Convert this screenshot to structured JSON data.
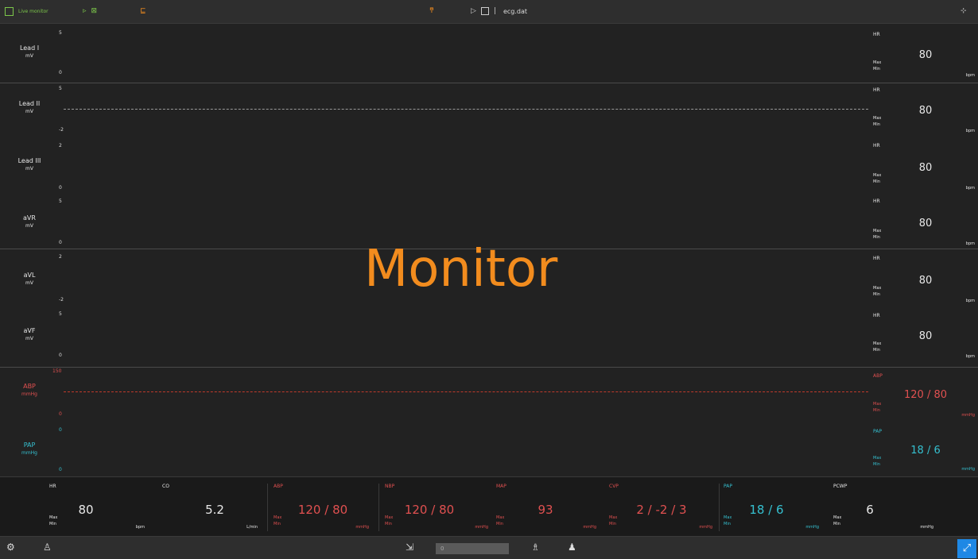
{
  "colors": {
    "green": "#7cc74a",
    "orange": "#f28c1e",
    "red": "#e05050",
    "cyan": "#35c0d0",
    "white": "#e8e8e8"
  },
  "topbar": {
    "logo_text": "Live monitor",
    "play_icon": "play-icon",
    "step_icon": "step-icon",
    "record_icon": "record-icon",
    "alarm_icon": "alarm-icon",
    "pause_icon": "pause-icon",
    "forward_icon": "forward-icon",
    "stop_icon": "stop-icon",
    "file_name": "ecg.dat",
    "settings_icon": "settings-icon"
  },
  "channels": [
    {
      "label": "Lead I",
      "unit": "mV",
      "top": "5",
      "bottom": "0"
    },
    {
      "label": "Lead II",
      "unit": "mV",
      "top": "5",
      "bottom": "-2"
    },
    {
      "label": "Lead III",
      "unit": "mV",
      "top": "2",
      "bottom": "0"
    },
    {
      "label": "aVR",
      "unit": "mV",
      "top": "5",
      "bottom": "0"
    },
    {
      "label": "aVL",
      "unit": "mV",
      "top": "2",
      "bottom": "-2"
    },
    {
      "label": "aVF",
      "unit": "mV",
      "top": "5",
      "bottom": "0"
    },
    {
      "label": "ABP",
      "unit": "mmHg",
      "top": "150",
      "bottom": "0"
    },
    {
      "label": "PAP",
      "unit": "mmHg",
      "top": "0",
      "bottom": "0"
    }
  ],
  "right_params": [
    {
      "label": "HR",
      "value": "80",
      "sub1": "Max",
      "sub2": "Min",
      "unit": "bpm"
    },
    {
      "label": "HR",
      "value": "80",
      "sub1": "Max",
      "sub2": "Min",
      "unit": "bpm"
    },
    {
      "label": "HR",
      "value": "80",
      "sub1": "Max",
      "sub2": "Min",
      "unit": "bpm"
    },
    {
      "label": "HR",
      "value": "80",
      "sub1": "Max",
      "sub2": "Min",
      "unit": "bpm"
    },
    {
      "label": "HR",
      "value": "80",
      "sub1": "Max",
      "sub2": "Min",
      "unit": "bpm"
    },
    {
      "label": "HR",
      "value": "80",
      "sub1": "Max",
      "sub2": "Min",
      "unit": "bpm"
    },
    {
      "label": "ABP",
      "value": "120 / 80",
      "sub1": "Max",
      "sub2": "Min",
      "unit": "mmHg"
    },
    {
      "label": "PAP",
      "value": "18 / 6",
      "sub1": "Max",
      "sub2": "Min",
      "unit": "mmHg"
    }
  ],
  "bottom_cells": [
    {
      "label": "HR",
      "value": "80",
      "sub1": "Max",
      "sub2": "Min",
      "unit": "bpm"
    },
    {
      "label": "CO",
      "value": "5.2",
      "sub1": "",
      "sub2": "",
      "unit": "L/min"
    },
    {
      "label": "ABP",
      "value": "120 / 80",
      "sub1": "Max",
      "sub2": "Min",
      "unit": "mmHg"
    },
    {
      "label": "NBP",
      "value": "120 / 80",
      "sub1": "Max",
      "sub2": "Min",
      "unit": "mmHg"
    },
    {
      "label": "MAP",
      "value": "93",
      "sub1": "Max",
      "sub2": "Min",
      "unit": "mmHg"
    },
    {
      "label": "CVP",
      "value": "2 / -2 / 3",
      "sub1": "Max",
      "sub2": "Min",
      "unit": "mmHg"
    },
    {
      "label": "PAP",
      "value": "18 / 6",
      "sub1": "Max",
      "sub2": "Min",
      "unit": "mmHg"
    },
    {
      "label": "PCWP",
      "value": "6",
      "sub1": "Max",
      "sub2": "Min",
      "unit": "mmHg"
    }
  ],
  "bottombar": {
    "gear_icon": "gear-icon",
    "user_icon": "user-icon",
    "export_icon": "export-icon",
    "slider_value": "0",
    "person_add_icon": "person-add-icon",
    "person_icon": "person-icon",
    "expand_icon": "expand-icon"
  },
  "watermark": "Monitor"
}
